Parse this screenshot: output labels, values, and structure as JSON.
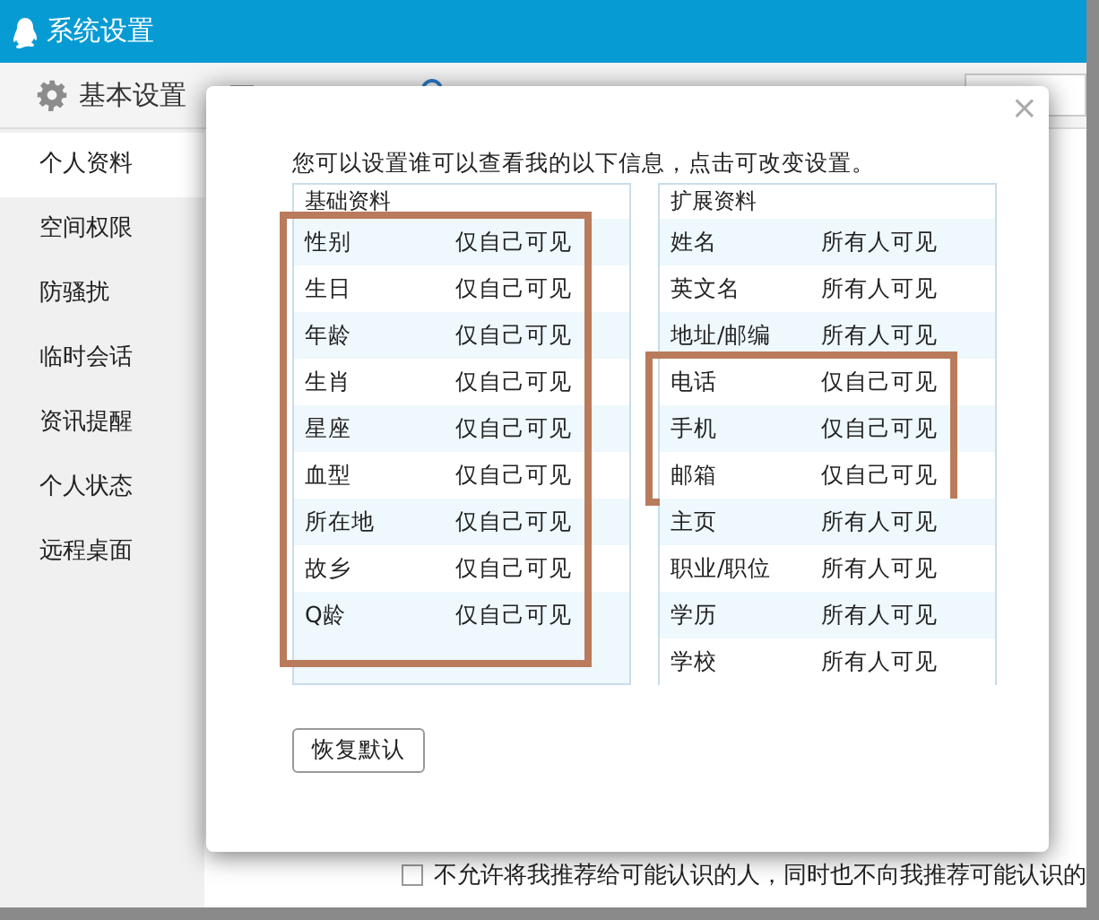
{
  "window": {
    "title": "系统设置"
  },
  "tabs": [
    {
      "label": "基本设置",
      "selected": true
    }
  ],
  "sidebar": {
    "items": [
      {
        "label": "个人资料",
        "selected": true
      },
      {
        "label": "空间权限",
        "selected": false
      },
      {
        "label": "防骚扰",
        "selected": false
      },
      {
        "label": "临时会话",
        "selected": false
      },
      {
        "label": "资讯提醒",
        "selected": false
      },
      {
        "label": "个人状态",
        "selected": false
      },
      {
        "label": "远程桌面",
        "selected": false
      }
    ]
  },
  "recommend_option": {
    "label": "不允许将我推荐给可能认识的人，同时也不向我推荐可能认识的",
    "checked": false
  },
  "dialog": {
    "close": "×",
    "intro": "您可以设置谁可以查看我的以下信息，点击可改变设置。",
    "tables": [
      {
        "title": "基础资料",
        "rows": [
          {
            "field": "性别",
            "visibility": "仅自己可见",
            "highlighted": true
          },
          {
            "field": "生日",
            "visibility": "仅自己可见",
            "highlighted": true
          },
          {
            "field": "年龄",
            "visibility": "仅自己可见",
            "highlighted": true
          },
          {
            "field": "生肖",
            "visibility": "仅自己可见",
            "highlighted": true
          },
          {
            "field": "星座",
            "visibility": "仅自己可见",
            "highlighted": true
          },
          {
            "field": "血型",
            "visibility": "仅自己可见",
            "highlighted": true
          },
          {
            "field": "所在地",
            "visibility": "仅自己可见",
            "highlighted": true
          },
          {
            "field": "故乡",
            "visibility": "仅自己可见",
            "highlighted": true
          },
          {
            "field": "Q龄",
            "visibility": "仅自己可见",
            "highlighted": true
          }
        ]
      },
      {
        "title": "扩展资料",
        "rows": [
          {
            "field": "姓名",
            "visibility": "所有人可见",
            "highlighted": false
          },
          {
            "field": "英文名",
            "visibility": "所有人可见",
            "highlighted": false
          },
          {
            "field": "地址/邮编",
            "visibility": "所有人可见",
            "highlighted": false
          },
          {
            "field": "电话",
            "visibility": "仅自己可见",
            "highlighted": true
          },
          {
            "field": "手机",
            "visibility": "仅自己可见",
            "highlighted": true
          },
          {
            "field": "邮箱",
            "visibility": "仅自己可见",
            "highlighted": true
          },
          {
            "field": "主页",
            "visibility": "所有人可见",
            "highlighted": false
          },
          {
            "field": "职业/职位",
            "visibility": "所有人可见",
            "highlighted": false
          },
          {
            "field": "学历",
            "visibility": "所有人可见",
            "highlighted": false
          },
          {
            "field": "学校",
            "visibility": "所有人可见",
            "highlighted": false
          }
        ]
      }
    ],
    "reset_button": "恢复默认"
  }
}
